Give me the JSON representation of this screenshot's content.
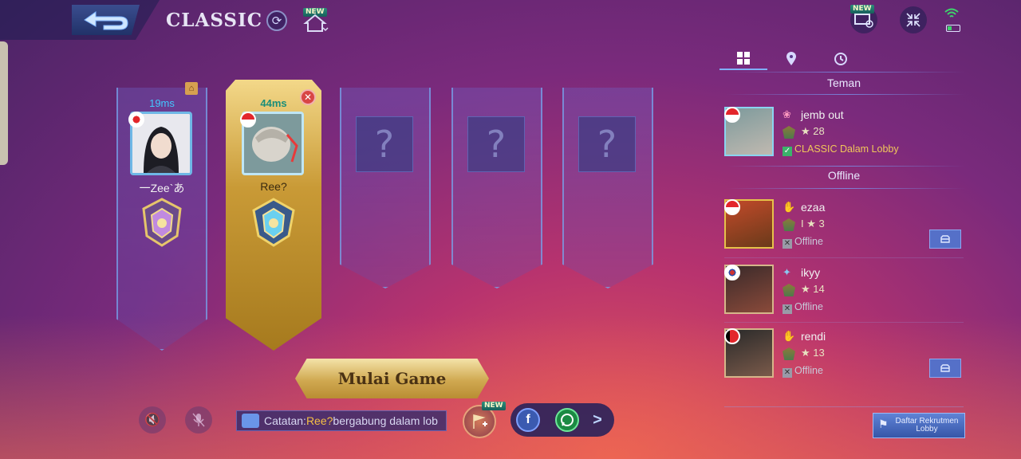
{
  "header": {
    "mode_title": "CLASSIC",
    "new_label": "NEW"
  },
  "slots": [
    {
      "ping": "19ms",
      "name": "一Zee`あ",
      "flag": "jp",
      "state": "member"
    },
    {
      "ping": "44ms",
      "name": "Ree?",
      "flag": "id",
      "state": "self"
    },
    {
      "state": "empty",
      "placeholder": "?"
    },
    {
      "state": "empty",
      "placeholder": "?"
    },
    {
      "state": "empty",
      "placeholder": "?"
    }
  ],
  "start_button": {
    "label": "Mulai Game"
  },
  "notice": {
    "prefix": "Catatan:",
    "player": "Ree?",
    "suffix": " bergabung dalam lob"
  },
  "invite": {
    "new_label": "NEW"
  },
  "share": {
    "facebook": "f",
    "more": ">"
  },
  "friends_panel": {
    "section_friends": "Teman",
    "section_offline": "Offline",
    "online": [
      {
        "name": "jemb out",
        "stars": "★ 28",
        "status": "CLASSIC Dalam Lobby",
        "flag": "id"
      }
    ],
    "offline": [
      {
        "name": "ezaa",
        "stars": "I   ★ 3",
        "status": "Offline",
        "flag": "id",
        "has_msg": true
      },
      {
        "name": "ikyy",
        "stars": "★ 14",
        "status": "Offline",
        "flag": "kr",
        "has_msg": false
      },
      {
        "name": "rendi",
        "stars": "★ 13",
        "status": "Offline",
        "flag": "tl",
        "has_msg": true
      }
    ]
  },
  "recruit_button": {
    "label": "Daftar Rekrutmen Lobby"
  },
  "top_right": {
    "new_label": "NEW"
  }
}
